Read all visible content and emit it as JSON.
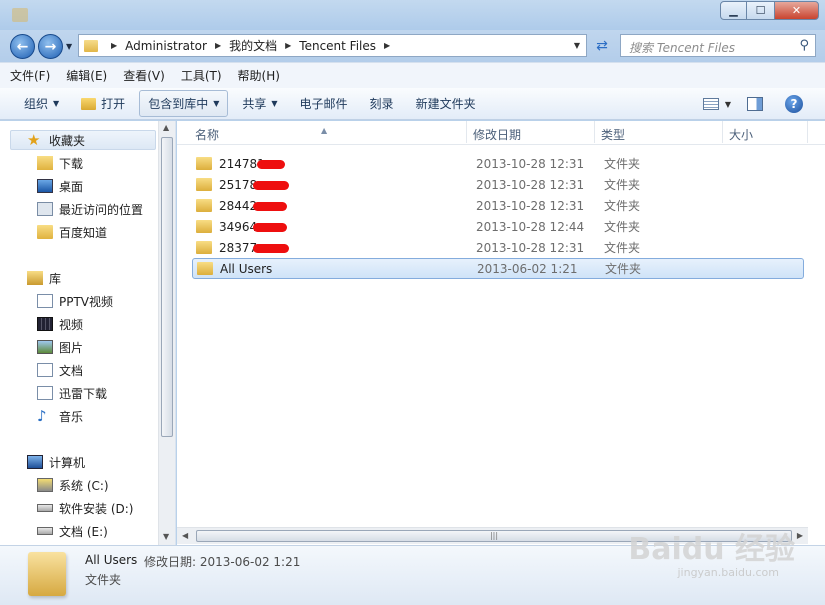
{
  "window": {
    "title_text": "",
    "min_glyph": "▁",
    "max_glyph": "☐",
    "close_glyph": "✕"
  },
  "address": {
    "crumbs": [
      "Administrator",
      "我的文档",
      "Tencent Files"
    ],
    "search_placeholder": "搜索 Tencent Files"
  },
  "menu": [
    "文件(F)",
    "编辑(E)",
    "查看(V)",
    "工具(T)",
    "帮助(H)"
  ],
  "commands": {
    "organize": "组织",
    "open": "打开",
    "include": "包含到库中",
    "share": "共享",
    "email": "电子邮件",
    "burn": "刻录",
    "new_folder": "新建文件夹"
  },
  "nav": {
    "favorites": "收藏夹",
    "downloads": "下载",
    "desktop": "桌面",
    "recent": "最近访问的位置",
    "baidu": "百度知道",
    "libraries": "库",
    "pptv": "PPTV视频",
    "videos": "视频",
    "pictures": "图片",
    "documents": "文档",
    "xunlei": "迅雷下载",
    "music": "音乐",
    "computer": "计算机",
    "drive_c": "系统 (C:)",
    "drive_d": "软件安装 (D:)",
    "drive_e": "文档 (E:)"
  },
  "columns": {
    "name": "名称",
    "date": "修改日期",
    "type": "类型",
    "size": "大小"
  },
  "files": [
    {
      "name": "214781",
      "date": "2013-10-28 12:31",
      "type": "文件夹"
    },
    {
      "name": "25178",
      "date": "2013-10-28 12:31",
      "type": "文件夹"
    },
    {
      "name": "28442",
      "date": "2013-10-28 12:31",
      "type": "文件夹"
    },
    {
      "name": "34964",
      "date": "2013-10-28 12:44",
      "type": "文件夹"
    },
    {
      "name": "28377",
      "date": "2013-10-28 12:31",
      "type": "文件夹"
    },
    {
      "name": "All Users",
      "date": "2013-06-02 1:21",
      "type": "文件夹"
    }
  ],
  "details": {
    "name": "All Users",
    "meta": "修改日期: 2013-06-02 1:21",
    "type": "文件夹"
  },
  "watermark": {
    "brand": "Baidu 经验",
    "url": "jingyan.baidu.com"
  }
}
